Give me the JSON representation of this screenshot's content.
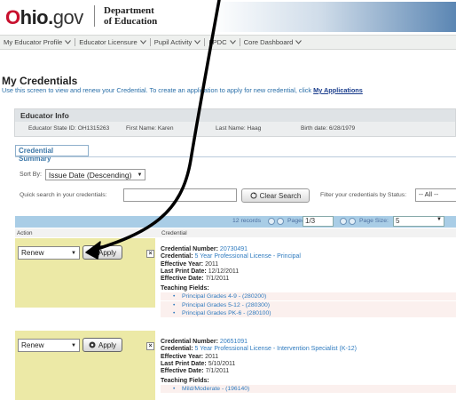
{
  "header": {
    "logo_o": "O",
    "logo_hio": "hio.",
    "logo_gov": "gov",
    "dept_line1": "Department",
    "dept_line2": "of Education"
  },
  "menu": [
    {
      "label": "My Educator Profile"
    },
    {
      "label": "Educator Licensure"
    },
    {
      "label": "Pupil Activity"
    },
    {
      "label": "LPDC"
    },
    {
      "label": "Core Dashboard"
    }
  ],
  "page": {
    "title": "My Credentials",
    "instructions": "Use this screen to view and renew your Credential. To create an application to apply for new credential, click",
    "instructions_link": "My Applications"
  },
  "educator_info": {
    "heading": "Educator Info",
    "state_id": "Educator State ID: OH1315263",
    "first_name": "First Name: Karen",
    "last_name": "Last Name: Haag",
    "birth_date": "Birth date: 6/28/1979"
  },
  "summary": {
    "tab_label": "Credential Summary",
    "sort_label": "Sort By:",
    "sort_value": "Issue Date (Descending)",
    "search_label": "Quick search in your credentials:",
    "search_value": "",
    "clear_label": "Clear Search",
    "filter_label": "Filter your credentials by Status:",
    "filter_value": "-- All --"
  },
  "pager": {
    "records": "12 records",
    "page_label": "Page#",
    "page_value": "1/3",
    "page_size_label": "Page Size:",
    "page_size_value": "5"
  },
  "columns": {
    "action": "Action",
    "credential": "Credential"
  },
  "labels": {
    "credential_number": "Credential Number:",
    "credential": "Credential:",
    "effective_year": "Effective Year:",
    "last_print_date": "Last Print Date:",
    "effective_date": "Effective Date:",
    "teaching_fields": "Teaching Fields:"
  },
  "records": [
    {
      "action": "Renew",
      "apply_label": "Apply",
      "credential_number": "20730491",
      "credential": "5 Year Professional License - Principal",
      "effective_year": "2011",
      "last_print_date": "12/12/2011",
      "effective_date": "7/1/2011",
      "teaching_fields": [
        "Principal Grades 4-9 - (280200)",
        "Principal Grades 5-12 - (280300)",
        "Principal Grades PK-6 - (280100)"
      ]
    },
    {
      "action": "Renew",
      "apply_label": "Apply",
      "credential_number": "20651091",
      "credential": "5 Year Professional License - Intervention Specialist (K-12)",
      "effective_year": "2011",
      "last_print_date": "5/10/2011",
      "effective_date": "7/1/2011",
      "teaching_fields": [
        "Mild/Moderate - (196140)"
      ]
    }
  ],
  "colors": {
    "accent_red": "#c8102e",
    "link_blue": "#2f7bbf",
    "pager_bg": "#a9cde6",
    "action_bg": "#ece9a6"
  }
}
